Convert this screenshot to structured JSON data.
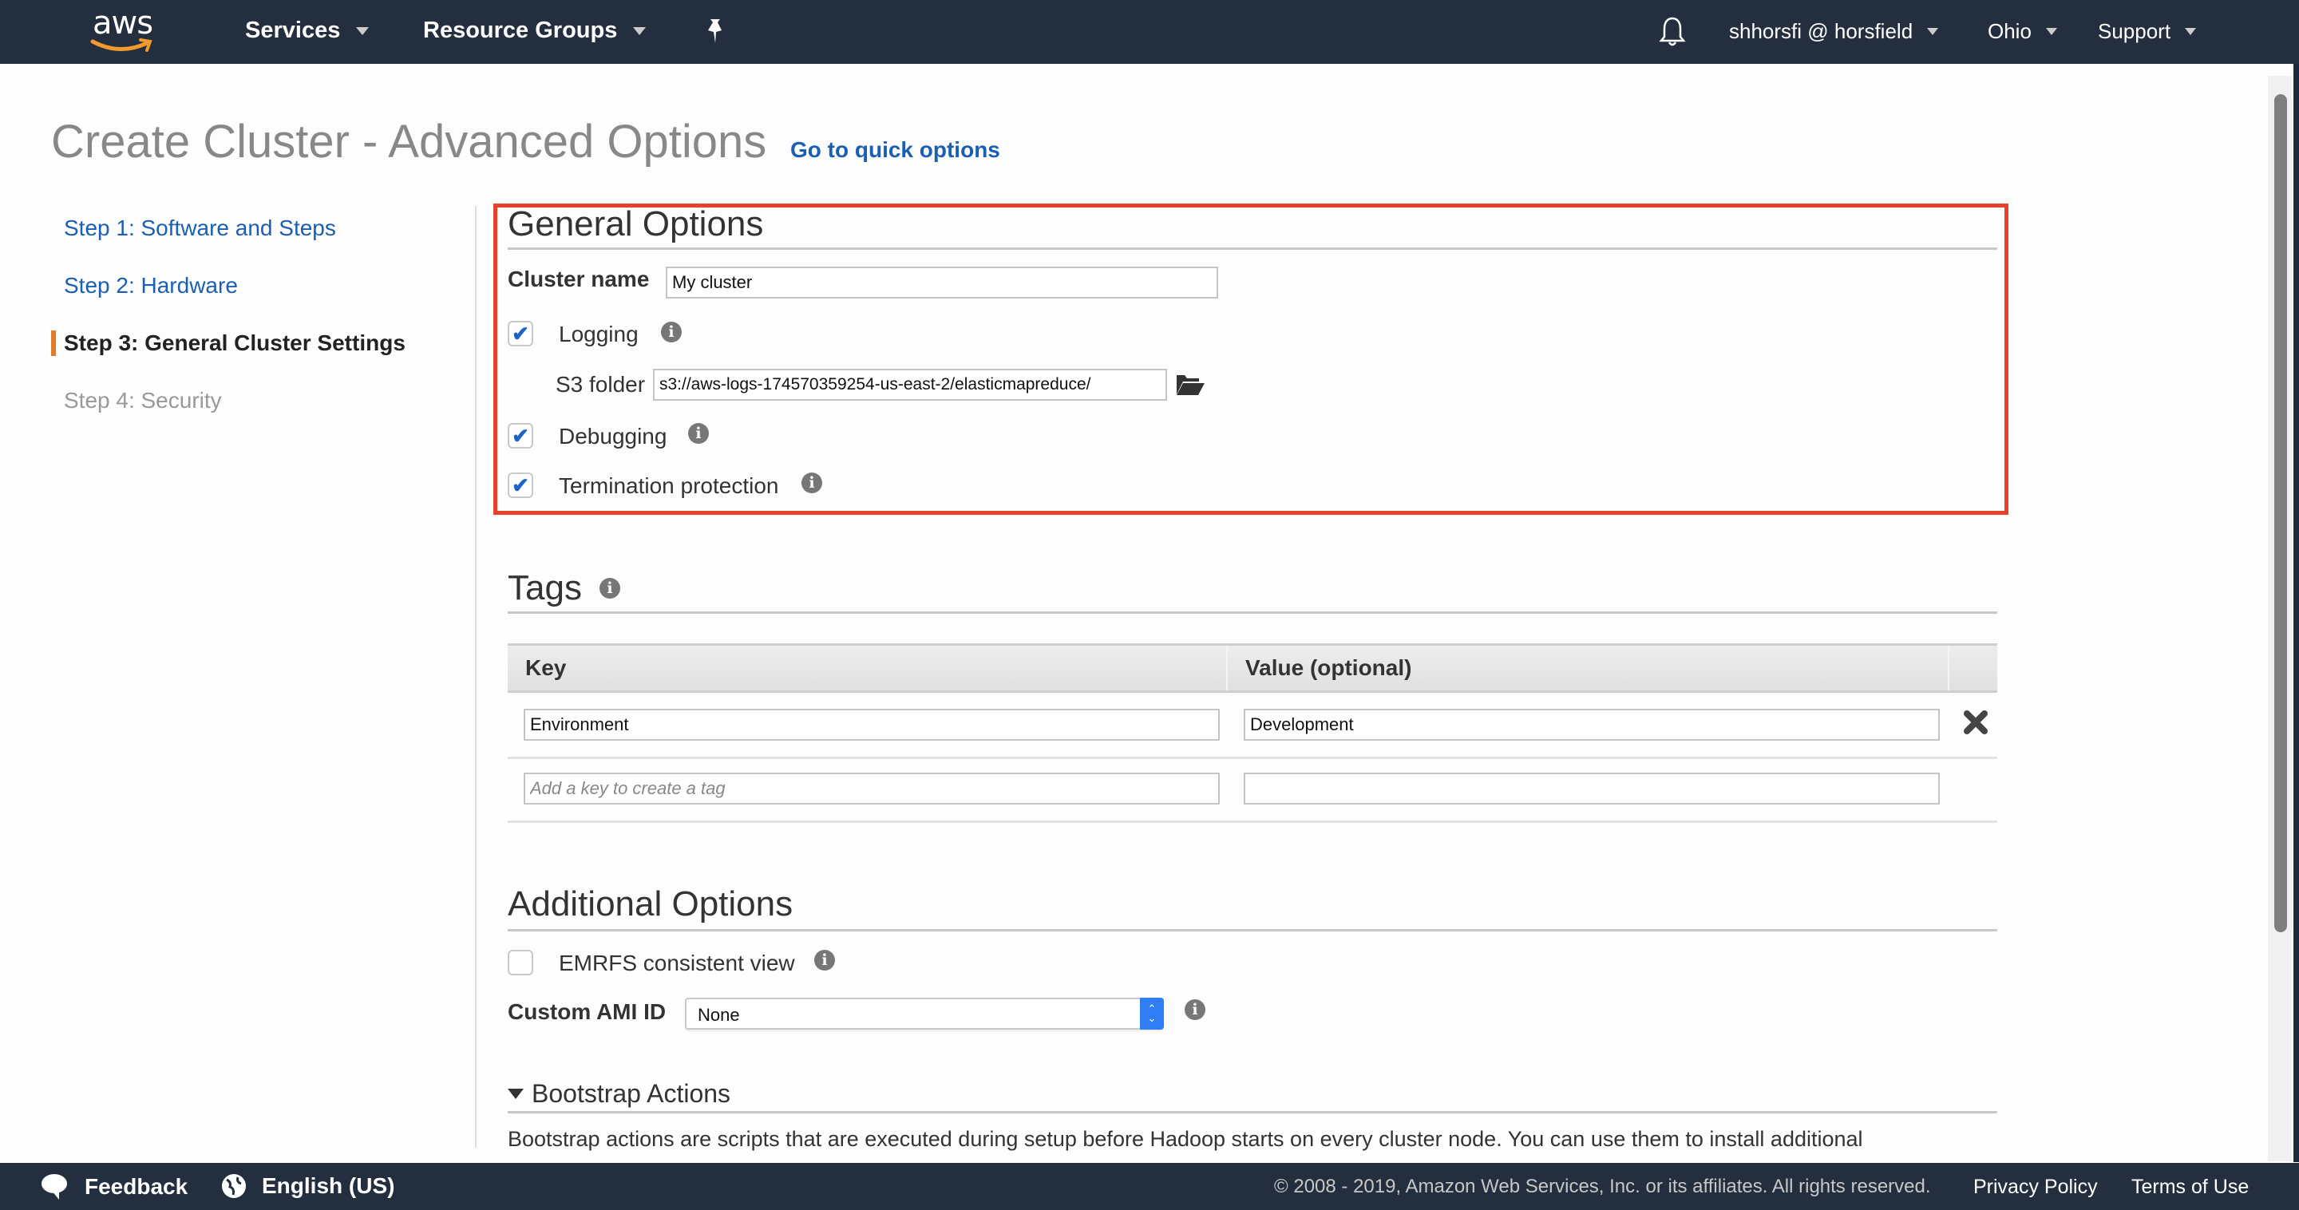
{
  "topnav": {
    "logo_text": "aws",
    "services_label": "Services",
    "resource_groups_label": "Resource Groups",
    "account_label": "shhorsfi @ horsfield",
    "region_label": "Ohio",
    "support_label": "Support"
  },
  "page": {
    "title": "Create Cluster - Advanced Options",
    "quick_options_link": "Go to quick options"
  },
  "steps": [
    {
      "label": "Step 1: Software and Steps",
      "state": "link"
    },
    {
      "label": "Step 2: Hardware",
      "state": "link"
    },
    {
      "label": "Step 3: General Cluster Settings",
      "state": "active"
    },
    {
      "label": "Step 4: Security",
      "state": "disabled"
    }
  ],
  "general_options": {
    "title": "General Options",
    "cluster_name_label": "Cluster name",
    "cluster_name_value": "My cluster",
    "logging_label": "Logging",
    "logging_checked": true,
    "s3_folder_label": "S3 folder",
    "s3_folder_value": "s3://aws-logs-174570359254-us-east-2/elasticmapreduce/",
    "debugging_label": "Debugging",
    "debugging_checked": true,
    "termination_label": "Termination protection",
    "termination_checked": true
  },
  "tags": {
    "title": "Tags",
    "columns": [
      "Key",
      "Value (optional)"
    ],
    "rows": [
      {
        "key": "Environment",
        "value": "Development"
      }
    ],
    "new_key_placeholder": "Add a key to create a tag",
    "new_value": ""
  },
  "additional_options": {
    "title": "Additional Options",
    "emrfs_label": "EMRFS consistent view",
    "emrfs_checked": false,
    "custom_ami_label": "Custom AMI ID",
    "custom_ami_value": "None"
  },
  "bootstrap": {
    "title": "Bootstrap Actions",
    "description": "Bootstrap actions are scripts that are executed during setup before Hadoop starts on every cluster node. You can use them to install additional"
  },
  "footer": {
    "feedback_label": "Feedback",
    "language_label": "English (US)",
    "copyright": "© 2008 - 2019, Amazon Web Services, Inc. or its affiliates. All rights reserved.",
    "privacy_label": "Privacy Policy",
    "terms_label": "Terms of Use"
  },
  "colors": {
    "nav_bg": "#232f3e",
    "link": "#1a5fb4",
    "active_step_marker": "#e07b2a",
    "highlight_border": "#e8412b",
    "checkbox_check": "#1e64c8",
    "aws_smile": "#f29a2e"
  }
}
